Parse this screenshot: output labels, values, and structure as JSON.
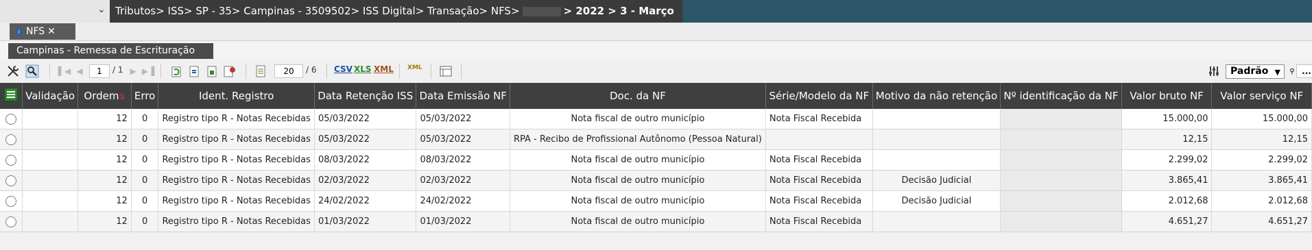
{
  "breadcrumb": {
    "prefix": "Tributos> ISS> SP - 35> Campinas - 3509502> ISS Digital> Transação> NFS>",
    "suffix": "> 2022 > 3 - Março"
  },
  "tab": {
    "label": "NFS",
    "close": "✕"
  },
  "panel": {
    "title": "Campinas - Remessa de Escrituração"
  },
  "toolbar": {
    "page_current": "1",
    "page_total": "/ 1",
    "rows_per_page": "20",
    "rows_total": "/ 6",
    "csv": "CSV",
    "xls": "XLS",
    "xml": "XML",
    "xml2": "XML",
    "view_select": "Padrão",
    "more": "..."
  },
  "columns": [
    "Validação",
    "Ordem",
    "Erro",
    "Ident. Registro",
    "Data Retenção ISS",
    "Data Emissão NF",
    "Doc. da NF",
    "Série/Modelo da NF",
    "Motivo da não retenção",
    "Nº identificação da NF",
    "Valor bruto NF",
    "Valor serviço NF"
  ],
  "rows": [
    {
      "ordem": "12",
      "erro": "0",
      "ident": "Registro tipo R - Notas Recebidas",
      "data_ret": "05/03/2022",
      "data_emi": "05/03/2022",
      "doc": "Nota fiscal de outro município",
      "serie": "Nota Fiscal Recebida",
      "motivo": "",
      "valor_bruto": "15.000,00",
      "valor_servico": "15.000,00"
    },
    {
      "ordem": "12",
      "erro": "0",
      "ident": "Registro tipo R - Notas Recebidas",
      "data_ret": "05/03/2022",
      "data_emi": "05/03/2022",
      "doc": "RPA - Recibo de Profissional Autônomo (Pessoa Natural)",
      "serie": "",
      "motivo": "",
      "valor_bruto": "12,15",
      "valor_servico": "12,15"
    },
    {
      "ordem": "12",
      "erro": "0",
      "ident": "Registro tipo R - Notas Recebidas",
      "data_ret": "08/03/2022",
      "data_emi": "08/03/2022",
      "doc": "Nota fiscal de outro município",
      "serie": "Nota Fiscal Recebida",
      "motivo": "",
      "valor_bruto": "2.299,02",
      "valor_servico": "2.299,02"
    },
    {
      "ordem": "12",
      "erro": "0",
      "ident": "Registro tipo R - Notas Recebidas",
      "data_ret": "02/03/2022",
      "data_emi": "02/03/2022",
      "doc": "Nota fiscal de outro município",
      "serie": "Nota Fiscal Recebida",
      "motivo": "Decisão Judicial",
      "valor_bruto": "3.865,41",
      "valor_servico": "3.865,41"
    },
    {
      "ordem": "12",
      "erro": "0",
      "ident": "Registro tipo R - Notas Recebidas",
      "data_ret": "24/02/2022",
      "data_emi": "24/02/2022",
      "doc": "Nota fiscal de outro município",
      "serie": "Nota Fiscal Recebida",
      "motivo": "Decisão Judicial",
      "valor_bruto": "2.012,68",
      "valor_servico": "2.012,68"
    },
    {
      "ordem": "12",
      "erro": "0",
      "ident": "Registro tipo R - Notas Recebidas",
      "data_ret": "01/03/2022",
      "data_emi": "01/03/2022",
      "doc": "Nota fiscal de outro município",
      "serie": "Nota Fiscal Recebida",
      "motivo": "",
      "valor_bruto": "4.651,27",
      "valor_servico": "4.651,27"
    }
  ]
}
